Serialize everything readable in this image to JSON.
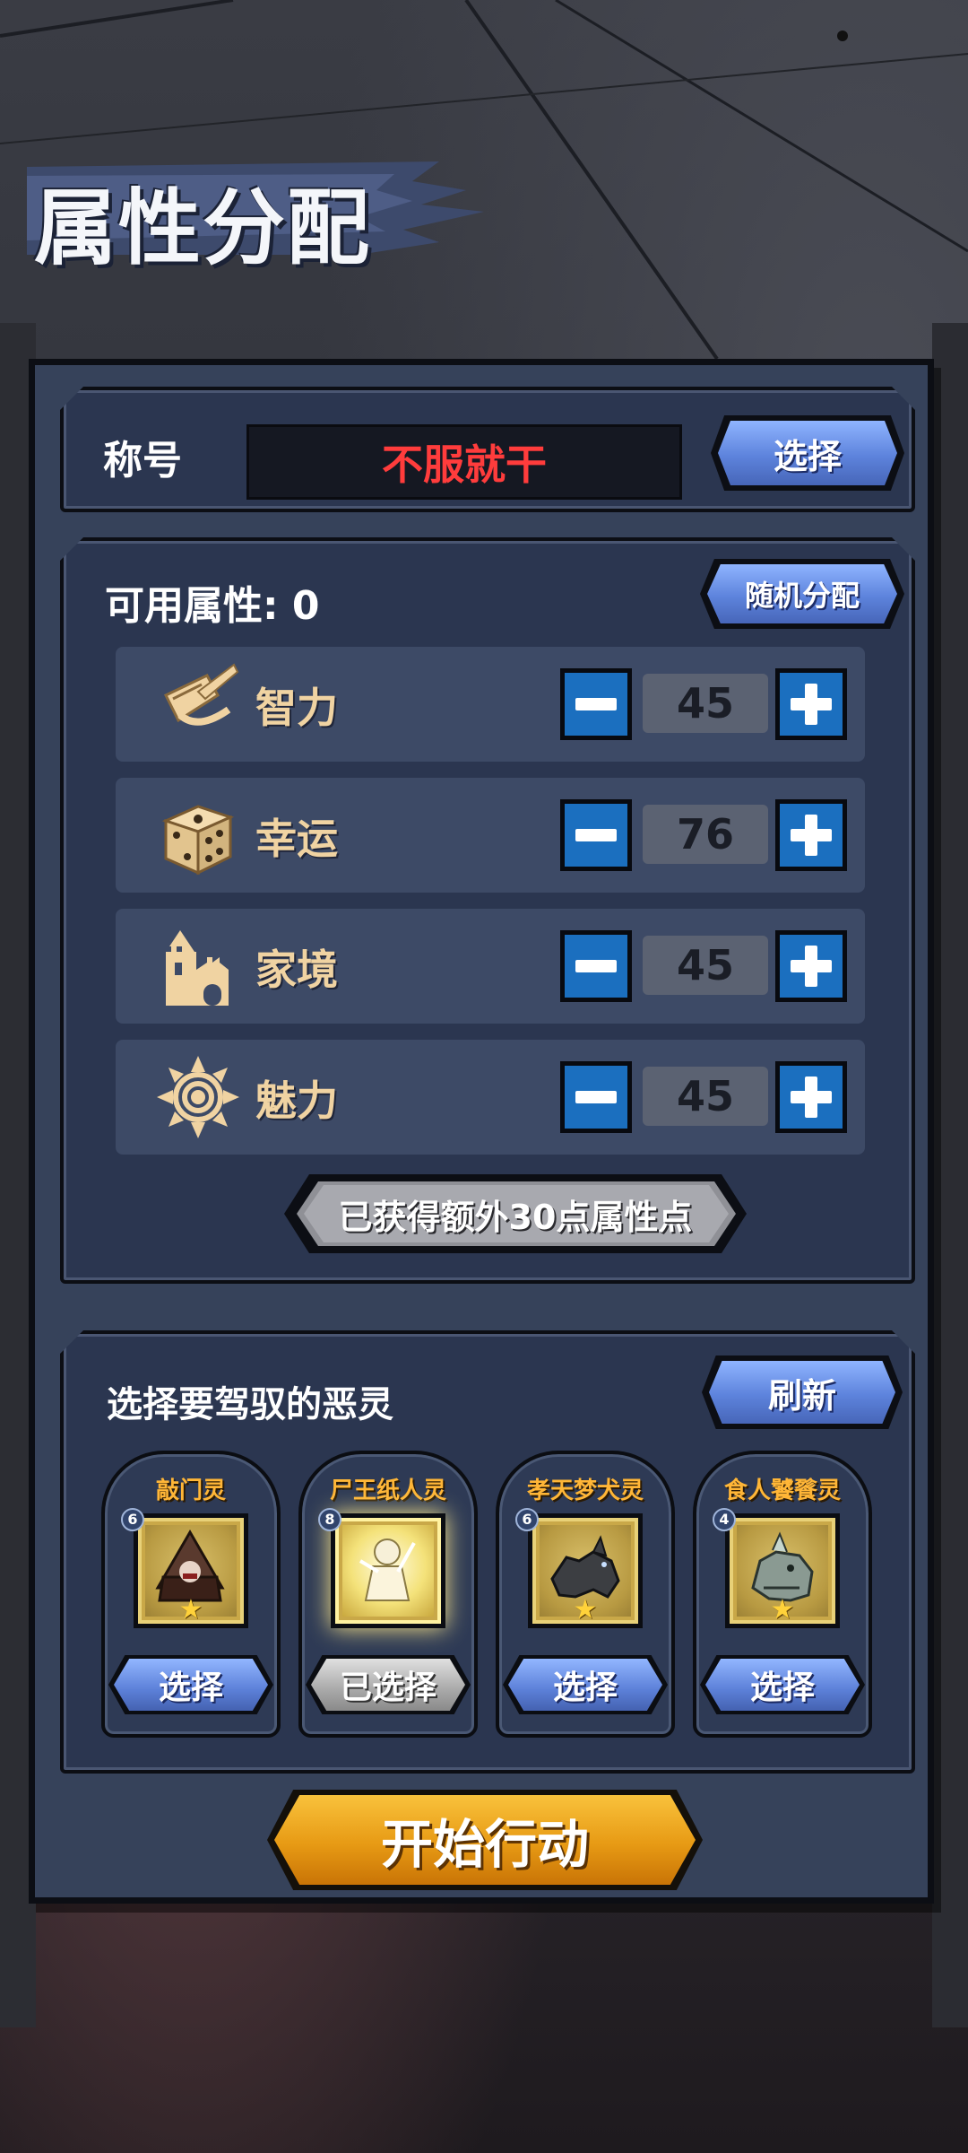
{
  "page_title": "属性分配",
  "title_row": {
    "label": "称号",
    "value": "不服就干",
    "select_label": "选择"
  },
  "attributes": {
    "available_label": "可用属性: 0",
    "random_label": "随机分配",
    "items": [
      {
        "name": "智力",
        "value": "45",
        "icon": "scroll-quill-icon"
      },
      {
        "name": "幸运",
        "value": "76",
        "icon": "dice-icon"
      },
      {
        "name": "家境",
        "value": "45",
        "icon": "castle-icon"
      },
      {
        "name": "魅力",
        "value": "45",
        "icon": "sun-charm-icon"
      }
    ],
    "bonus_text": "已获得额外30点属性点"
  },
  "spirits": {
    "heading": "选择要驾驭的恶灵",
    "refresh_label": "刷新",
    "cards": [
      {
        "name": "敲门灵",
        "level": "6",
        "button": "选择",
        "selected": false
      },
      {
        "name": "尸王纸人灵",
        "level": "8",
        "button": "已选择",
        "selected": true
      },
      {
        "name": "孝天梦犬灵",
        "level": "6",
        "button": "选择",
        "selected": false
      },
      {
        "name": "食人饕餮灵",
        "level": "4",
        "button": "选择",
        "selected": false
      }
    ]
  },
  "start_label": "开始行动",
  "colors": {
    "panel": "#36425a",
    "name_red": "#ff3c3c",
    "attr_gold": "#f0d3a2",
    "spirit_orange": "#ffb637",
    "start_orange": "#e79a14",
    "step_blue": "#1b6fbf"
  }
}
